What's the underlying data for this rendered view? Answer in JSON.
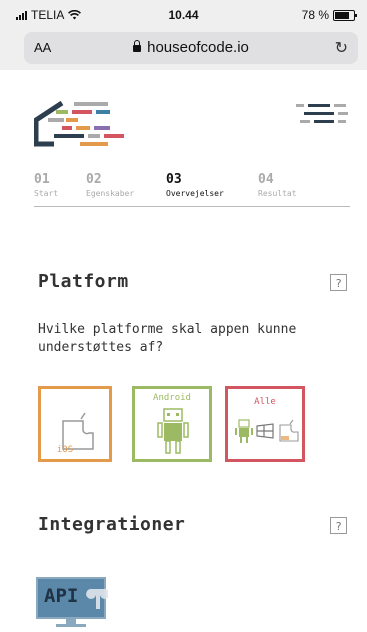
{
  "status_bar": {
    "carrier": "TELIA",
    "time": "10.44",
    "battery": "78 %",
    "battery_level": 0.78
  },
  "browser": {
    "text_size_label": "AA",
    "url": "houseofcode.io"
  },
  "steps": [
    {
      "num": "01",
      "label": "Start"
    },
    {
      "num": "02",
      "label": "Egenskaber"
    },
    {
      "num": "03",
      "label": "Overvejelser",
      "active": true
    },
    {
      "num": "04",
      "label": "Resultat"
    }
  ],
  "platform_section": {
    "title": "Platform",
    "help": "?",
    "question": "Hvilke platforme skal appen kunne understøttes af?",
    "options": [
      {
        "name": "ios",
        "label": "iOS",
        "color": "#e39a4b"
      },
      {
        "name": "android",
        "label": "Android",
        "color": "#9cba63"
      },
      {
        "name": "all",
        "label": "Alle",
        "color": "#d2555f"
      }
    ]
  },
  "integrations_section": {
    "title": "Integrationer",
    "help": "?",
    "api_label": "API"
  },
  "colors": {
    "ios": "#e39a4b",
    "android": "#9cba63",
    "all": "#d2555f",
    "logo_dark": "#2d3e4f"
  }
}
